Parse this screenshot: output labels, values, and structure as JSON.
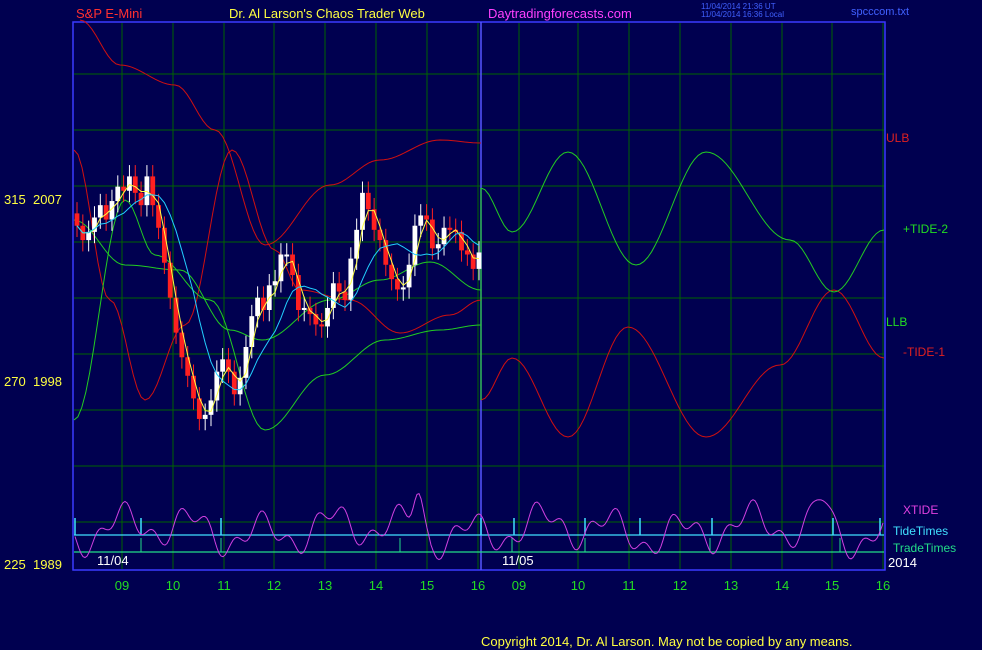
{
  "header": {
    "symbol": "S&P E-Mini",
    "brand": "Dr. Al Larson's Chaos Trader Web",
    "site": "Daytradingforecasts.com",
    "utc_time": "11/04/2014 21:36 UT",
    "local_time": "11/04/2014 16:36 Local",
    "file": "spcccom.txt"
  },
  "footer": {
    "copyright": "Copyright 2014, Dr. Al Larson. May not be copied by any means."
  },
  "colors": {
    "background": "#000050",
    "frame": "#3a3aff",
    "grid": "#006400",
    "ulb_llb_red": "#d01010",
    "green": "#22cc22",
    "yellow": "#ffff44",
    "cyan": "#22d0ff",
    "magenta": "#d040e0",
    "up_candle": "#ffffff",
    "down_candle": "#ff2020",
    "tidetimes": "#40e0ff",
    "tradetimes": "#22dd88"
  },
  "chart_data": {
    "type": "line",
    "title": "S&P E-Mini",
    "x_axis": {
      "day_labels": [
        "11/04",
        "11/05"
      ],
      "hour_ticks": [
        "09",
        "10",
        "11",
        "12",
        "13",
        "14",
        "15",
        "16",
        "09",
        "10",
        "11",
        "12",
        "13",
        "14",
        "15",
        "16"
      ],
      "year_label": "2014"
    },
    "y_axis": {
      "labels": [
        {
          "cycle": "315",
          "price": "2007"
        },
        {
          "cycle": "270",
          "price": "1998"
        },
        {
          "cycle": "225",
          "price": "1989"
        }
      ],
      "price_range": [
        1989,
        2007
      ]
    },
    "series_labels": {
      "ulb": "ULB",
      "llb": "LLB",
      "tide2": "+TIDE-2",
      "tide1": "-TIDE-1",
      "xtide": "XTIDE",
      "tidetimes": "TideTimes",
      "tradetimes": "TradeTimes"
    },
    "closes_day1": [
      2005.7,
      2005.0,
      2005.4,
      2006.1,
      2006.7,
      2006.0,
      2006.9,
      2007.6,
      2007.4,
      2008.1,
      2007.3,
      2006.7,
      2008.1,
      2006.7,
      2005.6,
      2003.9,
      2002.2,
      2000.5,
      1999.3,
      1998.4,
      1997.3,
      1996.3,
      1996.5,
      1997.2,
      1998.6,
      1999.2,
      1998.6,
      1997.5,
      1998.3,
      1999.8,
      2001.3,
      2002.2,
      2001.6,
      2002.8,
      2003.0,
      2004.3,
      2004.3,
      2003.3,
      2001.6,
      2001.7,
      2001.4,
      2000.9,
      2000.8,
      2001.7,
      2002.9,
      2002.5,
      2002.1,
      2004.1,
      2005.5,
      2007.3,
      2006.5,
      2005.5,
      2005.0,
      2003.8,
      2003.1,
      2002.6,
      2002.7,
      2003.8,
      2005.7,
      2006.2,
      2006.0,
      2004.6,
      2004.8,
      2005.6,
      2005.5,
      2005.4,
      2004.5,
      2004.3,
      2003.6,
      2004.4
    ],
    "cycle_axes": {
      "tide2_green": {
        "min": 270,
        "max": 315
      },
      "ulb_red": {
        "min": 270,
        "max": 315
      }
    }
  }
}
